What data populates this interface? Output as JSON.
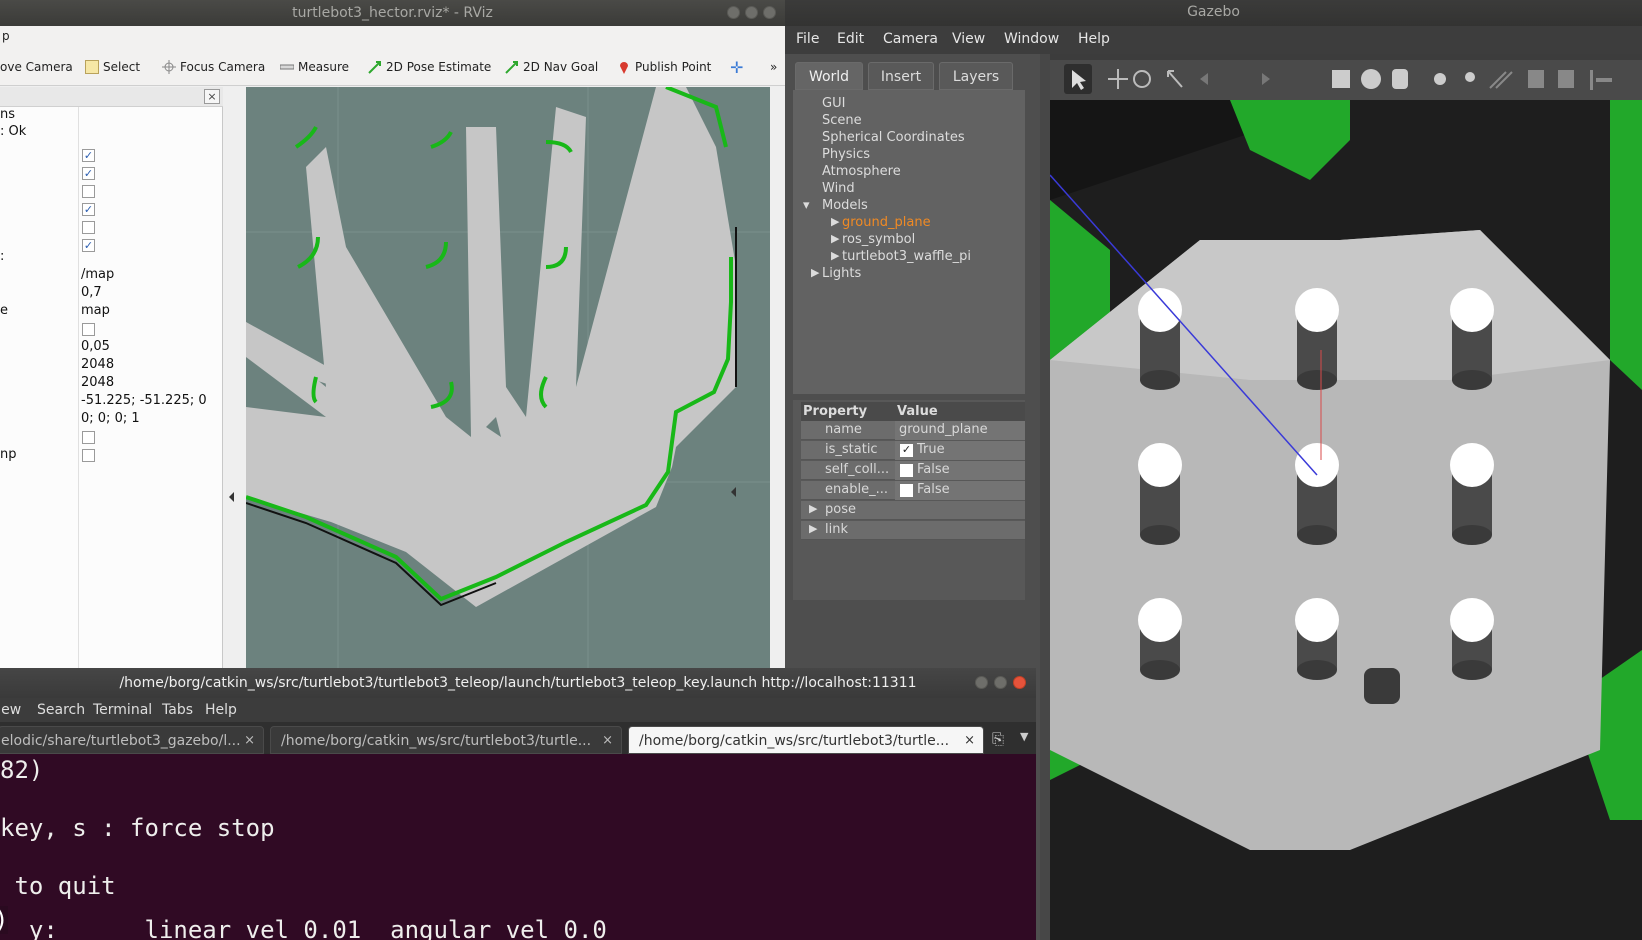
{
  "rviz": {
    "title": "turtlebot3_hector.rviz* - RViz",
    "menu_fragment": "p",
    "toolbar": {
      "move_camera": "ove Camera",
      "select": "Select",
      "focus_camera": "Focus Camera",
      "measure": "Measure",
      "pose_estimate": "2D Pose Estimate",
      "nav_goal": "2D Nav Goal",
      "publish_point": "Publish Point",
      "more": "»"
    },
    "left_panel": {
      "close": "×",
      "labels": [
        "ns",
        ": Ok",
        "",
        "",
        "",
        "",
        "",
        "",
        ":",
        "",
        "",
        "e",
        "",
        "",
        "",
        "",
        "",
        "",
        "np"
      ],
      "values": [
        "/map",
        "0,7",
        "map",
        "0,05",
        "2048",
        "2048",
        "-51.225; -51.225; 0",
        "0; 0; 0; 1"
      ]
    }
  },
  "gazebo": {
    "title": "Gazebo",
    "menu": [
      "File",
      "Edit",
      "Camera",
      "View",
      "Window",
      "Help"
    ],
    "tabs": [
      "World",
      "Insert",
      "Layers"
    ],
    "tree": {
      "items": [
        "GUI",
        "Scene",
        "Spherical Coordinates",
        "Physics",
        "Atmosphere",
        "Wind",
        "Models"
      ],
      "models": [
        "ground_plane",
        "ros_symbol",
        "turtlebot3_waffle_pi"
      ],
      "lights": "Lights"
    },
    "properties": {
      "header_property": "Property",
      "header_value": "Value",
      "rows": [
        {
          "key": "name",
          "value": "ground_plane"
        },
        {
          "key": "is_static",
          "value": "True"
        },
        {
          "key": "self_coll...",
          "value": "False"
        },
        {
          "key": "enable_...",
          "value": "False"
        }
      ],
      "groups": [
        "pose",
        "link"
      ]
    },
    "colors": {
      "selected_model": "#f08a24",
      "wall_green": "#22a82a"
    }
  },
  "terminal": {
    "title": "/home/borg/catkin_ws/src/turtlebot3/turtlebot3_teleop/launch/turtlebot3_teleop_key.launch http://localhost:11311",
    "menu": [
      "View",
      "Search",
      "Terminal",
      "Tabs",
      "Help"
    ],
    "tabs": [
      "elodic/share/turtlebot3_gazebo/l...",
      "/home/borg/catkin_ws/src/turtlebot3/turtle...",
      "/home/borg/catkin_ws/src/turtlebot3/turtle..."
    ],
    "lines": [
      "82)",
      "",
      "key, s : force stop",
      "",
      " to quit",
      "",
      ")",
      "  y:      linear vel 0.01  angular vel 0.0"
    ]
  }
}
